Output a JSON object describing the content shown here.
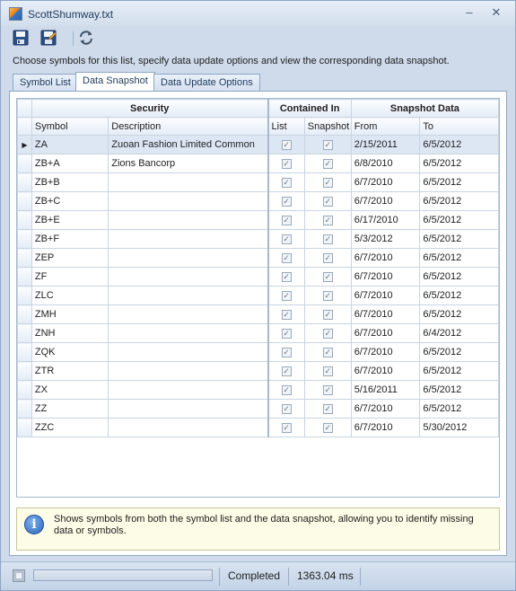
{
  "window": {
    "title": "ScottShumway.txt"
  },
  "toolbar": {
    "save_icon": "save-icon",
    "save_as_icon": "save-as-icon",
    "refresh_icon": "refresh-icon"
  },
  "instruction": "Choose symbols for this list, specify data update options and view the corresponding data snapshot.",
  "tabs": [
    {
      "label": "Symbol List",
      "active": false
    },
    {
      "label": "Data Snapshot",
      "active": true
    },
    {
      "label": "Data Update Options",
      "active": false
    }
  ],
  "grid": {
    "groups": {
      "security": "Security",
      "contained_in": "Contained In",
      "snapshot_data": "Snapshot Data"
    },
    "columns": {
      "symbol": "Symbol",
      "description": "Description",
      "list": "List",
      "snapshot": "Snapshot",
      "from": "From",
      "to": "To"
    },
    "rows": [
      {
        "symbol": "ZA",
        "description": "Zuoan Fashion Limited Common",
        "list": true,
        "snapshot": true,
        "from": "2/15/2011",
        "to": "6/5/2012"
      },
      {
        "symbol": "ZB+A",
        "description": "Zions Bancorp",
        "list": true,
        "snapshot": true,
        "from": "6/8/2010",
        "to": "6/5/2012"
      },
      {
        "symbol": "ZB+B",
        "description": "",
        "list": true,
        "snapshot": true,
        "from": "6/7/2010",
        "to": "6/5/2012"
      },
      {
        "symbol": "ZB+C",
        "description": "",
        "list": true,
        "snapshot": true,
        "from": "6/7/2010",
        "to": "6/5/2012"
      },
      {
        "symbol": "ZB+E",
        "description": "",
        "list": true,
        "snapshot": true,
        "from": "6/17/2010",
        "to": "6/5/2012"
      },
      {
        "symbol": "ZB+F",
        "description": "",
        "list": true,
        "snapshot": true,
        "from": "5/3/2012",
        "to": "6/5/2012"
      },
      {
        "symbol": "ZEP",
        "description": "",
        "list": true,
        "snapshot": true,
        "from": "6/7/2010",
        "to": "6/5/2012"
      },
      {
        "symbol": "ZF",
        "description": "",
        "list": true,
        "snapshot": true,
        "from": "6/7/2010",
        "to": "6/5/2012"
      },
      {
        "symbol": "ZLC",
        "description": "",
        "list": true,
        "snapshot": true,
        "from": "6/7/2010",
        "to": "6/5/2012"
      },
      {
        "symbol": "ZMH",
        "description": "",
        "list": true,
        "snapshot": true,
        "from": "6/7/2010",
        "to": "6/5/2012"
      },
      {
        "symbol": "ZNH",
        "description": "",
        "list": true,
        "snapshot": true,
        "from": "6/7/2010",
        "to": "6/4/2012"
      },
      {
        "symbol": "ZQK",
        "description": "",
        "list": true,
        "snapshot": true,
        "from": "6/7/2010",
        "to": "6/5/2012"
      },
      {
        "symbol": "ZTR",
        "description": "",
        "list": true,
        "snapshot": true,
        "from": "6/7/2010",
        "to": "6/5/2012"
      },
      {
        "symbol": "ZX",
        "description": "",
        "list": true,
        "snapshot": true,
        "from": "5/16/2011",
        "to": "6/5/2012"
      },
      {
        "symbol": "ZZ",
        "description": "",
        "list": true,
        "snapshot": true,
        "from": "6/7/2010",
        "to": "6/5/2012"
      },
      {
        "symbol": "ZZC",
        "description": "",
        "list": true,
        "snapshot": true,
        "from": "6/7/2010",
        "to": "5/30/2012"
      }
    ]
  },
  "info": {
    "icon": "info-icon",
    "text": "Shows symbols from both the symbol list and the data snapshot, allowing you to identify missing data or symbols."
  },
  "status": {
    "state": "Completed",
    "elapsed": "1363.04 ms",
    "progress": 0
  }
}
